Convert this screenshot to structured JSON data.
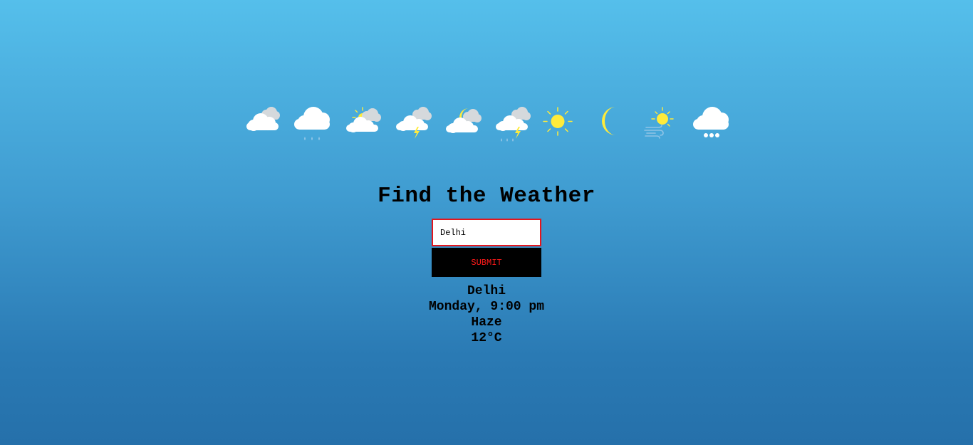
{
  "icons": [
    {
      "name": "cloudy-icon"
    },
    {
      "name": "rain-icon"
    },
    {
      "name": "partly-sunny-icon"
    },
    {
      "name": "thunderstorm-icon"
    },
    {
      "name": "partly-cloudy-night-icon"
    },
    {
      "name": "thunder-rain-icon"
    },
    {
      "name": "sun-icon"
    },
    {
      "name": "moon-icon"
    },
    {
      "name": "windy-sun-icon"
    },
    {
      "name": "snow-icon"
    }
  ],
  "colors": {
    "sun": "#ffeb3b",
    "cloud": "#ffffff",
    "cloud_gray": "#d5d9dc",
    "rain": "#8fc4e6",
    "input_border": "#e4161d",
    "button_bg": "#000000",
    "button_text": "#ff1a1a"
  },
  "page": {
    "title": "Find the Weather"
  },
  "search": {
    "value": "Delhi",
    "placeholder": "",
    "submit_label": "SUBMIT"
  },
  "result": {
    "city": "Delhi",
    "datetime": "Monday, 9:00 pm",
    "condition": "Haze",
    "temperature": "12°C"
  }
}
